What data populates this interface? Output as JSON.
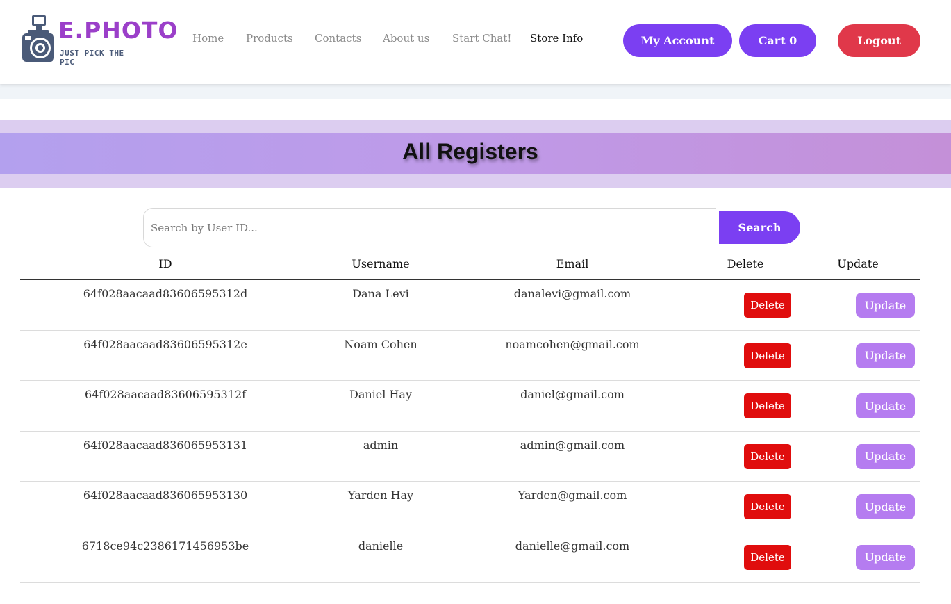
{
  "brand": {
    "name": "E.PHOTO",
    "tagline": "JUST PICK THE PIC",
    "icon": "camera-icon",
    "color": "#9b3fc9"
  },
  "nav": {
    "items": [
      {
        "label": "Home",
        "active": false
      },
      {
        "label": "Products",
        "active": false
      },
      {
        "label": "Contacts",
        "active": false
      },
      {
        "label": "About us",
        "active": false
      },
      {
        "label": "Start Chat!",
        "active": false
      },
      {
        "label": "Store Info",
        "active": true
      }
    ]
  },
  "actions": {
    "account_label": "My Account",
    "cart_label": "Cart 0",
    "logout_label": "Logout"
  },
  "colors": {
    "primary": "#7b3ff2",
    "danger": "#e00d0d",
    "logout": "#e0384a",
    "update": "#b57cf0"
  },
  "page": {
    "title": "All Registers"
  },
  "search": {
    "placeholder": "Search by User ID...",
    "value": "",
    "button_label": "Search"
  },
  "table": {
    "columns": [
      "ID",
      "Username",
      "Email",
      "Delete",
      "Update"
    ],
    "delete_label": "Delete",
    "update_label": "Update",
    "rows": [
      {
        "id": "64f028aacaad83606595312d",
        "username": "Dana Levi",
        "email": "danalevi@gmail.com"
      },
      {
        "id": "64f028aacaad83606595312e",
        "username": "Noam Cohen",
        "email": "noamcohen@gmail.com"
      },
      {
        "id": "64f028aacaad83606595312f",
        "username": "Daniel Hay",
        "email": "daniel@gmail.com"
      },
      {
        "id": "64f028aacaad836065953131",
        "username": "admin",
        "email": "admin@gmail.com"
      },
      {
        "id": "64f028aacaad836065953130",
        "username": "Yarden Hay",
        "email": "Yarden@gmail.com"
      },
      {
        "id": "6718ce94c2386171456953be",
        "username": "danielle",
        "email": "danielle@gmail.com"
      }
    ]
  }
}
